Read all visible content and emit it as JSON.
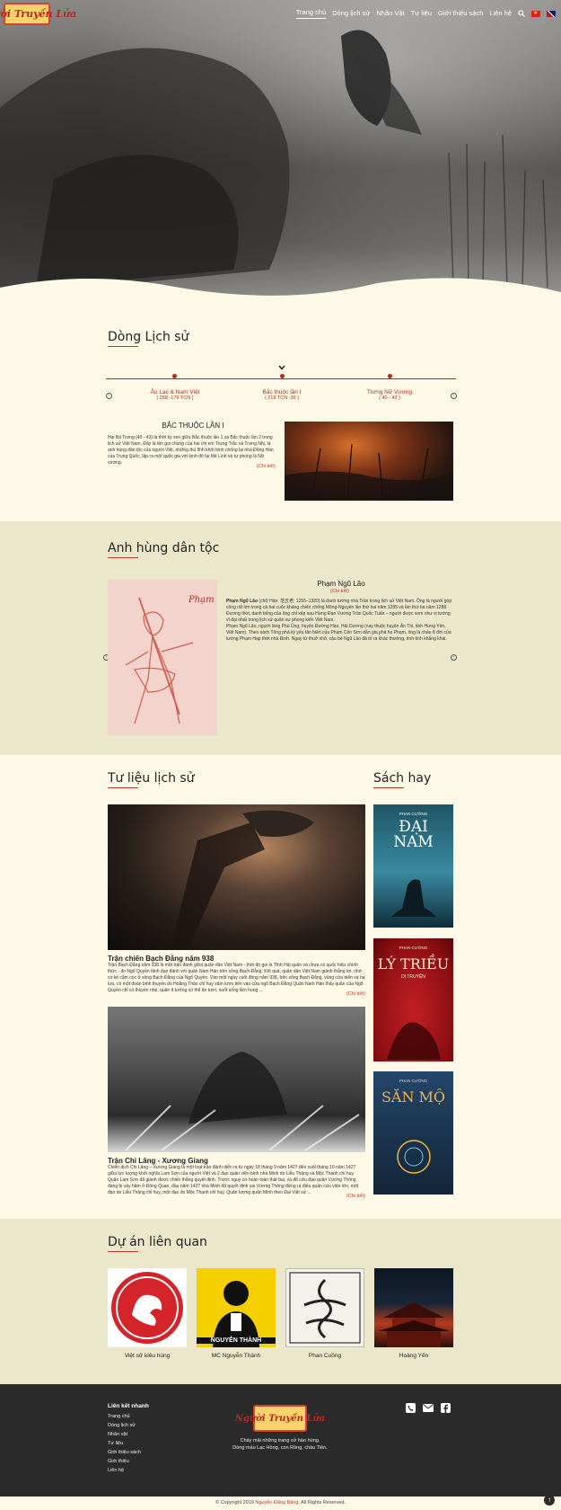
{
  "header": {
    "logo_text": "Người Truyền Lửa",
    "nav": [
      "Trang chủ",
      "Dòng lịch sử",
      "Nhân Vật",
      "Tư liệu",
      "Giới thiệu sách",
      "Liên hệ"
    ],
    "active": "Trang chủ"
  },
  "history": {
    "title": "Dòng Lịch sử",
    "periods": [
      {
        "name": "Âu Lạc & Nam Việt",
        "years": "( 258 -179 TCN )"
      },
      {
        "name": "Bắc thuộc lần I",
        "years": "( 218 TCN -39 )"
      },
      {
        "name": "Trưng Nữ Vương",
        "years": "( 40 - 43 )"
      }
    ],
    "article_title": "BẮC THUỘC LẦN I",
    "article_text": "Hai Bà Trưng (40 - 43) là thời kỳ xen giữa Bắc thuộc lần 1 và Bắc thuộc lần 2 trong lịch sử Việt Nam. Đây là tên gọi chung của hai chị em Trưng Trắc và Trưng Nhị, là anh hùng dân tộc của người Việt, những thủ lĩnh khởi binh chống lại nhà Đông Hán của Trung Quốc, lập ra một quốc gia với kinh đô tại Mê Linh và tự phong là Nữ vương.",
    "more": "(Chi tiết)"
  },
  "heroes": {
    "title": "Anh hùng dân tộc",
    "name": "Phạm Ngũ Lão",
    "more": "(Chi tiết)",
    "text_bold": "Phạm Ngũ Lão",
    "text1": " (chữ Hán: 范五老; 1255–1320) là danh tướng nhà Trần trong lịch sử Việt Nam. Ông là người góp công rất lớn trong cả hai cuộc kháng chiến chống Mông-Nguyên lần thứ hai năm 1285 và lần thứ ba năm 1288. Đương thời, danh tiếng của ông chỉ xếp sau Hưng Đạo Vương Trần Quốc Tuấn – người được xem như vị tướng vĩ đại nhất trong lịch sử quân sự phong kiến Việt Nam.",
    "text2": "Phạm Ngũ Lão, người làng Phù Ủng, huyện Đường Hào, Hải Dương (nay thuộc huyện Ân Thi, tỉnh Hưng Yên, Việt Nam). Theo sách Tông phả kỳ yếu tân biên của Phạm Côn Sơn dẫn gia phả họ Phạm, ông là cháu 8 đời của tướng Phạm Hạp thời nhà Đinh. Ngay từ thuở nhỏ, cậu bé Ngũ Lão đã tỏ ra khác thường, tính tình khẳng khái."
  },
  "docs": {
    "title": "Tư liệu lịch sử",
    "items": [
      {
        "title": "Trận chiến Bạch Đằng năm 938",
        "text": "Trận Bạch Đằng năm 938 là một trận đánh giữa quân dân Việt Nam - thời đó gọi là Tĩnh Hải quân và chưa có quốc hiệu chính thức - do Ngô Quyền lãnh đạo đánh với quân Nam Hán trên sông Bạch Đằng. Kết quả, quân dân Việt Nam giành thắng lợi, nhờ có kế cắm cọc ở sông Bạch Đằng của Ngô Quyền. Vào một ngày cuối đông năm 938, trên sông Bạch Đằng, vùng cửa biển và hạ lưu, có một đoàn binh thuyền do Hoằng Tháo chỉ huy xâm lược tiến vào cửa ngõ Bạch Đằng Quân Nam Hán thấy quân của Ngô Quyền chỉ có thuyền nhẹ, quân ít tưởng có thể ăn tươi, nuốt sống liền hung ...",
        "more": "(Chi tiết)"
      },
      {
        "title": "Trận Chi Lăng - Xương Giang",
        "text": "Chiến dịch Chi Lăng – Xương Giang là một loạt trận đánh diễn ra từ ngày 18 tháng 9 năm 1427 đến cuối tháng 10 năm 1427 giữa lực lượng khởi nghĩa Lam Sơn của người Việt và 2 đạo quân viện binh nhà Minh do Liễu Thăng và Mộc Thạnh chỉ huy. Quân Lam Sơn đã giành được chiến thắng quyết định. Trước nguy cơ hoàn toàn thất bại, và để cứu đạo quân Vương Thông đang bị vây hãm ở Đông Quan, đầu năm 1427 nhà Minh đã quyết định sai Vương Thông đứng ra điều quân cứu viện lớn, một đạo do Liễu Thăng chỉ huy, một đạo do Mộc Thạnh chỉ huy. Quân lượng quân Minh theo Đại Việt sử ...",
        "more": "(Chi tiết)"
      }
    ]
  },
  "books": {
    "title": "Sách hay",
    "items": [
      {
        "title": "ĐẠI NAM",
        "author": "PHAN CƯỜNG",
        "color": "#2a6f86"
      },
      {
        "title": "LÝ TRIỀU",
        "author": "PHAN CƯỜNG",
        "sub": "DỊ TRUYỆN",
        "color": "#b3151a"
      },
      {
        "title": "SĂN MỘ",
        "author": "PHAN CƯỜNG",
        "color": "#1c3d5e"
      }
    ]
  },
  "projects": {
    "title": "Dự án liên quan",
    "items": [
      {
        "label": "Việt sử kiêu hùng"
      },
      {
        "label": "MC Nguyễn Thành",
        "badge": "NGUYỄN THÀNH"
      },
      {
        "label": "Phan Cuồng"
      },
      {
        "label": "Hoàng Yến"
      }
    ]
  },
  "footer": {
    "links_title": "Liên kết nhanh",
    "links": [
      "Trang chủ",
      "Dòng lịch sử",
      "Nhân vật",
      "Tư liệu",
      "Giới thiệu sách",
      "Giới thiệu",
      "Liên hệ"
    ],
    "tagline1": "Cháy mãi những trang sử hào hùng.",
    "tagline2": "Dòng máu Lạc Hồng, con Rồng, cháu Tiên.",
    "copyright_pre": "© Copyright 2019 ",
    "copyright_name": "Nguyễn Đăng Băng",
    "copyright_post": ". All Rights Reserved."
  },
  "colors": {
    "accent": "#c0392b",
    "cream": "#fdf9e6",
    "beige": "#ebe7ca",
    "footer": "#2b2b2b"
  }
}
